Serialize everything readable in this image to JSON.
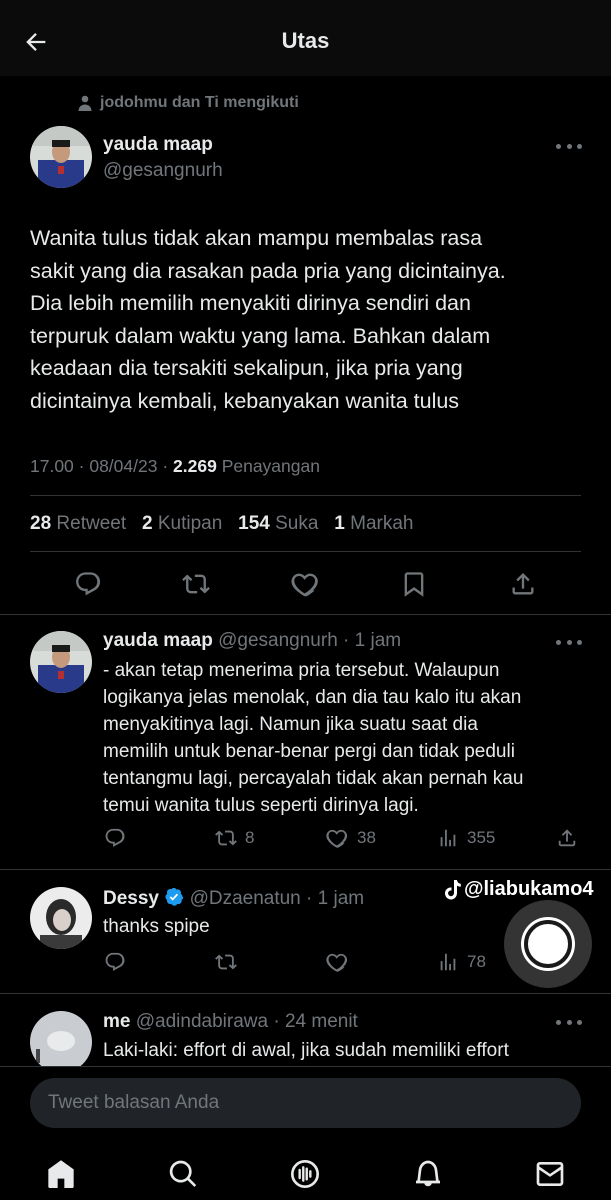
{
  "header": {
    "title": "Utas"
  },
  "social_context": "jodohmu dan Ti mengikuti",
  "main_tweet": {
    "display_name": "yauda maap",
    "handle": "@gesangnurh",
    "text_lines": [
      "Wanita tulus tidak akan mampu membalas rasa",
      "sakit yang dia rasakan pada pria yang dicintainya.",
      "Dia lebih memilih menyakiti dirinya sendiri dan",
      "terpuruk dalam waktu yang lama. Bahkan dalam",
      "keadaan dia tersakiti sekalipun, jika pria yang",
      "dicintainya kembali, kebanyakan wanita tulus"
    ],
    "time": "17.00 · 08/04/23 · ",
    "views_count": "2.269",
    "views_label": " Penayangan",
    "stats": {
      "retweets": "28",
      "retweets_label": " Retweet",
      "quotes": "2",
      "quotes_label": " Kutipan",
      "likes": "154",
      "likes_label": " Suka",
      "bookmarks": "1",
      "bookmarks_label": " Markah"
    }
  },
  "replies": [
    {
      "display_name": "yauda maap",
      "handle": "@gesangnurh",
      "time": "· 1 jam",
      "text_lines": [
        "- akan tetap menerima pria tersebut. Walaupun",
        "logikanya jelas menolak, dan dia tau kalo itu akan",
        "menyakitinya lagi. Namun jika suatu saat dia",
        "memilih untuk benar-benar pergi dan tidak peduli",
        "tentangmu lagi, percayalah tidak akan pernah kau",
        "temui wanita tulus seperti dirinya lagi."
      ],
      "retweets": "8",
      "likes": "38",
      "views": "355"
    },
    {
      "display_name": "Dessy",
      "handle": "@Dzaenatun",
      "time": "· 1 jam",
      "text_lines": [
        "thanks spipe"
      ],
      "views": "78"
    },
    {
      "display_name": "me",
      "handle": "@adindabirawa",
      "time": "· 24 menit",
      "text_lines": [
        "Laki-laki: effort di awal, jika sudah memiliki effort"
      ]
    }
  ],
  "watermark": "@liabukamo4",
  "reply_input": {
    "placeholder": "Tweet balasan Anda"
  },
  "colors": {
    "background": "#000000",
    "text": "#e7e9ea",
    "muted": "#71767b",
    "divider": "#2f3336",
    "verified": "#1d9bf0"
  }
}
